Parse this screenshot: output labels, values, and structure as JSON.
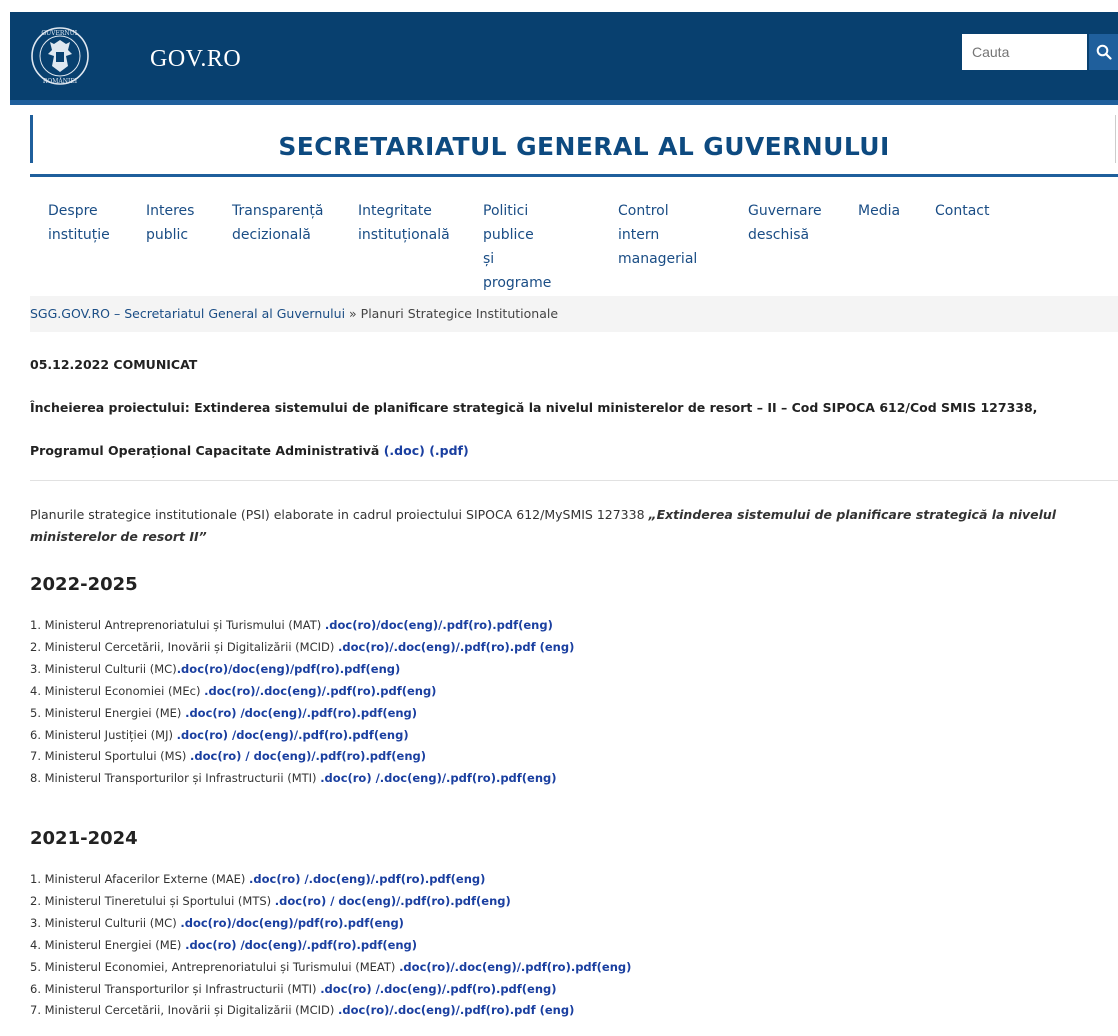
{
  "header": {
    "site_title": "GOV.RO",
    "search_placeholder": "Cauta",
    "crest_text_top": "GUVERNUL",
    "crest_text_bottom": "ROMÂNIEI"
  },
  "institution": {
    "title": "SECRETARIATUL GENERAL AL GUVERNULUI"
  },
  "nav": {
    "items": [
      {
        "label": "Despre\ninstituție"
      },
      {
        "label": "Interes\npublic"
      },
      {
        "label": "Transparență\ndecizională"
      },
      {
        "label": "Integritate\ninstituțională"
      },
      {
        "label": "Politici publice\nși programe"
      },
      {
        "label": "Control intern\nmanagerial"
      },
      {
        "label": "Guvernare\ndeschisă"
      },
      {
        "label": "Media"
      },
      {
        "label": "Contact"
      }
    ]
  },
  "breadcrumb": {
    "home": "SGG.GOV.RO – Secretariatul General al Guvernului",
    "separator": " » ",
    "current": "Planuri Strategice Institutionale"
  },
  "announcement": {
    "date_line": "05.12.2022 COMUNICAT",
    "title": "Încheierea proiectului: Extinderea sistemului de planificare strategică la nivelul ministerelor de resort – II – Cod SIPOCA 612/Cod SMIS 127338,",
    "program": "Programul Operațional Capacitate Administrativă ",
    "doc_link": "(.doc)",
    "pdf_link": "(.pdf)"
  },
  "intro": {
    "text": "Planurile strategice institutionale (PSI) elaborate in cadrul proiectului SIPOCA 612/MySMIS 127338 ",
    "emphasis": "„Extinderea sistemului de planificare strategică la nivelul ministerelor de resort II”"
  },
  "sections": [
    {
      "year": "2022-2025",
      "items": [
        {
          "text": "1. Ministerul Antreprenoriatului și Turismului (MAT) ",
          "links": ".doc(ro)/doc(eng)/.pdf(ro).pdf(eng)"
        },
        {
          "text": "2. Ministerul Cercetării, Inovării și Digitalizării (MCID) ",
          "links": ".doc(ro)/.doc(eng)/.pdf(ro).pdf (eng)"
        },
        {
          "text": "3. Ministerul Culturii (MC)",
          "links": ".doc(ro)/doc(eng)/pdf(ro).pdf(eng)"
        },
        {
          "text": "4. Ministerul Economiei (MEc) ",
          "links": ".doc(ro)/.doc(eng)/.pdf(ro).pdf(eng)"
        },
        {
          "text": "5. Ministerul Energiei (ME) ",
          "links": ".doc(ro) /doc(eng)/.pdf(ro).pdf(eng)"
        },
        {
          "text": "6. Ministerul Justiției (MJ) ",
          "links": ".doc(ro) /doc(eng)/.pdf(ro).pdf(eng)"
        },
        {
          "text": "7. Ministerul Sportului (MS) ",
          "links": ".doc(ro) / doc(eng)/.pdf(ro).pdf(eng)"
        },
        {
          "text": "8. Ministerul Transporturilor și Infrastructurii (MTI) ",
          "links": ".doc(ro) /.doc(eng)/.pdf(ro).pdf(eng)"
        }
      ]
    },
    {
      "year": "2021-2024",
      "items": [
        {
          "text": "1. Ministerul Afacerilor Externe (MAE) ",
          "links": ".doc(ro) /.doc(eng)/.pdf(ro).pdf(eng)"
        },
        {
          "text": "2. Ministerul Tineretului și Sportului (MTS) ",
          "links": ".doc(ro) / doc(eng)/.pdf(ro).pdf(eng)"
        },
        {
          "text": "3. Ministerul Culturii (MC) ",
          "links": ".doc(ro)/doc(eng)/pdf(ro).pdf(eng)"
        },
        {
          "text": "4. Ministerul Energiei (ME) ",
          "links": ".doc(ro) /doc(eng)/.pdf(ro).pdf(eng)"
        },
        {
          "text": "5. Ministerul Economiei, Antreprenoriatului și Turismului (MEAT) ",
          "links": ".doc(ro)/.doc(eng)/.pdf(ro).pdf(eng)"
        },
        {
          "text": "6. Ministerul Transporturilor și Infrastructurii (MTI) ",
          "links": ".doc(ro) /.doc(eng)/.pdf(ro).pdf(eng)"
        },
        {
          "text": "7. Ministerul Cercetării, Inovării și Digitalizării (MCID) ",
          "links": ".doc(ro)/.doc(eng)/.pdf(ro).pdf (eng)"
        }
      ]
    }
  ],
  "colors": {
    "header_bg": "#08406f",
    "accent": "#1f5f9c",
    "link": "#1a3fa0",
    "institution_title": "#0d4a80"
  },
  "icons": {
    "crest": "coat-of-arms-icon",
    "search": "search-icon"
  }
}
